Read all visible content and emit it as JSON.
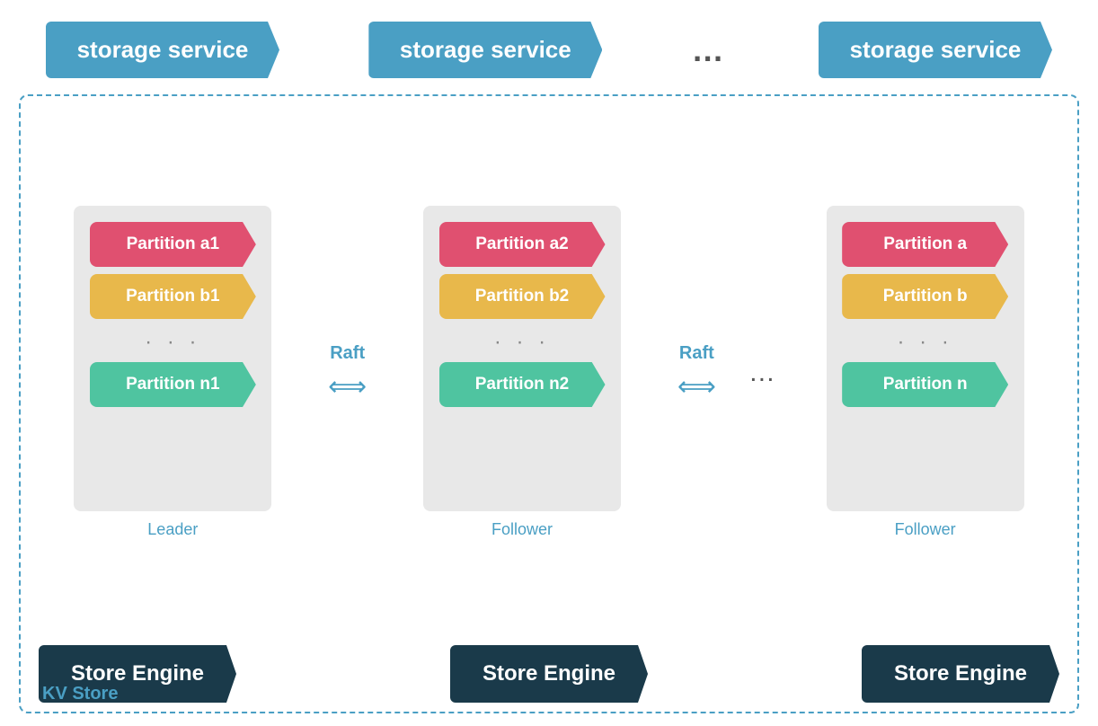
{
  "top": {
    "storage_services": [
      {
        "label": "storage service"
      },
      {
        "label": "storage service"
      },
      {
        "label": "storage service"
      }
    ],
    "dots": "…"
  },
  "servers": [
    {
      "id": "leader",
      "partitions": [
        {
          "label": "Partition a1",
          "color": "red"
        },
        {
          "label": "Partition b1",
          "color": "yellow"
        },
        {
          "label": "Partition n1",
          "color": "teal"
        }
      ],
      "role": "Leader"
    },
    {
      "id": "follower1",
      "partitions": [
        {
          "label": "Partition a2",
          "color": "red"
        },
        {
          "label": "Partition b2",
          "color": "yellow"
        },
        {
          "label": "Partition n2",
          "color": "teal"
        }
      ],
      "role": "Follower"
    },
    {
      "id": "follower2",
      "partitions": [
        {
          "label": "Partition a",
          "color": "red"
        },
        {
          "label": "Partition b",
          "color": "yellow"
        },
        {
          "label": "Partition n",
          "color": "teal"
        }
      ],
      "role": "Follower"
    }
  ],
  "raft": {
    "label": "Raft",
    "arrow": "⟺"
  },
  "mid_dots": "…",
  "store_engines": [
    {
      "label": "Store Engine"
    },
    {
      "label": "Store Engine"
    },
    {
      "label": "Store Engine"
    }
  ],
  "kv_store_label": "KV Store"
}
